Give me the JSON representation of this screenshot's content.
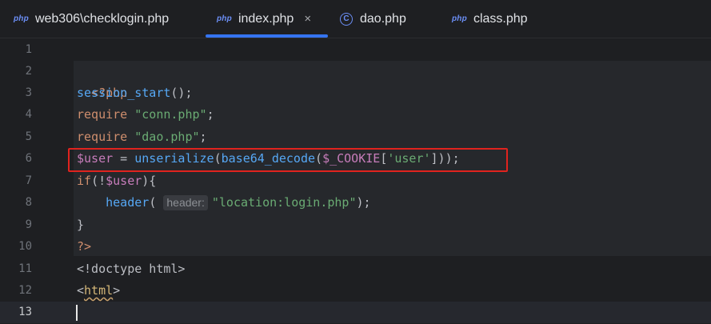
{
  "tabs": [
    {
      "icon": "php",
      "label": "web306\\checklogin.php"
    },
    {
      "icon": "php",
      "label": "index.php",
      "close": "×"
    },
    {
      "icon": "C",
      "label": "dao.php"
    },
    {
      "icon": "php",
      "label": "class.php"
    }
  ],
  "line_numbers": [
    "1",
    "2",
    "3",
    "4",
    "5",
    "6",
    "7",
    "8",
    "9",
    "10",
    "11",
    "12",
    "13"
  ],
  "code": {
    "l2": {
      "open": "<?php"
    },
    "l3": {
      "fn": "session_start",
      "rest": "();"
    },
    "l4": {
      "kw": "require",
      "sp": " ",
      "str": "\"conn.php\"",
      "end": ";"
    },
    "l5": {
      "kw": "require",
      "sp": " ",
      "str": "\"dao.php\"",
      "end": ";"
    },
    "l6": {
      "var1": "$user",
      "eq": " = ",
      "fn1": "unserialize",
      "p1": "(",
      "fn2": "base64_decode",
      "p2": "(",
      "var2": "$_COOKIE",
      "b1": "[",
      "str": "'user'",
      "b2": "]));"
    },
    "l7": {
      "kw": "if",
      "p1": "(!",
      "var": "$user",
      "p2": "){"
    },
    "l8": {
      "indent": "    ",
      "fn": "header",
      "p1": "( ",
      "hint": "header:",
      "str": "\"location:login.php\"",
      "end": ");"
    },
    "l9": {
      "close": "}"
    },
    "l10": {
      "close": "?>"
    },
    "l11": {
      "text": "<!doctype html>"
    },
    "l12": {
      "lt": "<",
      "tag": "html",
      "gt": ">"
    }
  }
}
